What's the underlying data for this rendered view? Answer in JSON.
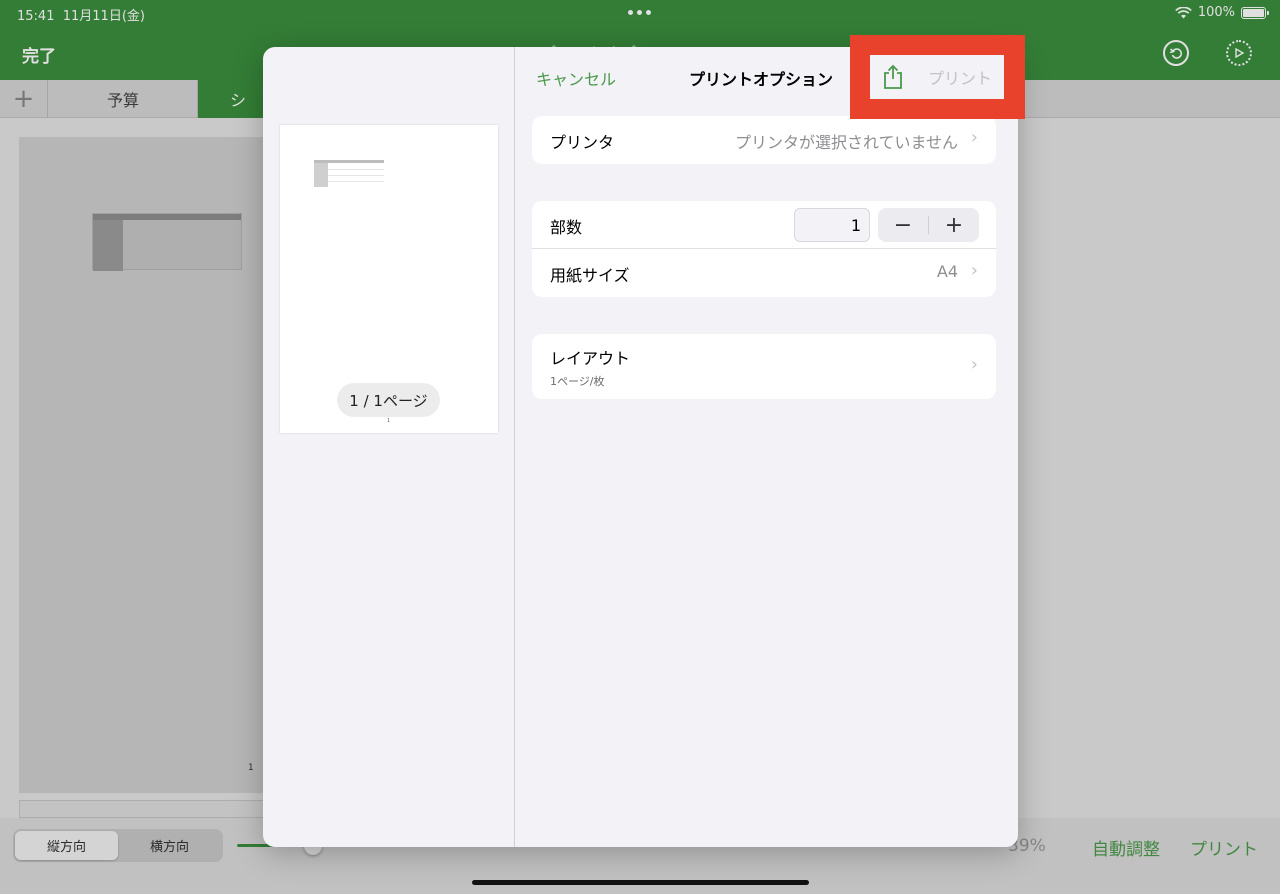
{
  "status_bar": {
    "time": "15:41",
    "date": "11月11日(金)",
    "battery": "100%"
  },
  "app_toolbar": {
    "done_label": "完了",
    "doc_title": "プリントオプション"
  },
  "tabs": [
    {
      "label": "予算"
    },
    {
      "label": "シ"
    }
  ],
  "background": {
    "page_number": "1"
  },
  "bottom_bar": {
    "orientation": {
      "portrait": "縦方向",
      "landscape": "横方向",
      "selected": "縦方向"
    },
    "zoom": "39%",
    "auto_fit_label": "自動調整",
    "print_label": "プリント"
  },
  "print_dialog": {
    "cancel_label": "キャンセル",
    "title": "プリントオプション",
    "print_label": "プリント",
    "page_indicator": "1 / 1ページ",
    "thumb_page_number": "1",
    "printer": {
      "label": "プリンタ",
      "value": "プリンタが選択されていません"
    },
    "copies": {
      "label": "部数",
      "value": "1",
      "minus": "−",
      "plus": "+"
    },
    "paper_size": {
      "label": "用紙サイズ",
      "value": "A4"
    },
    "layout": {
      "label": "レイアウト",
      "sublabel": "1ページ/枚"
    }
  },
  "colors": {
    "accent_green": "#3b8f3e",
    "highlight_red": "#e8412c",
    "link_green": "#4a9a4b"
  }
}
